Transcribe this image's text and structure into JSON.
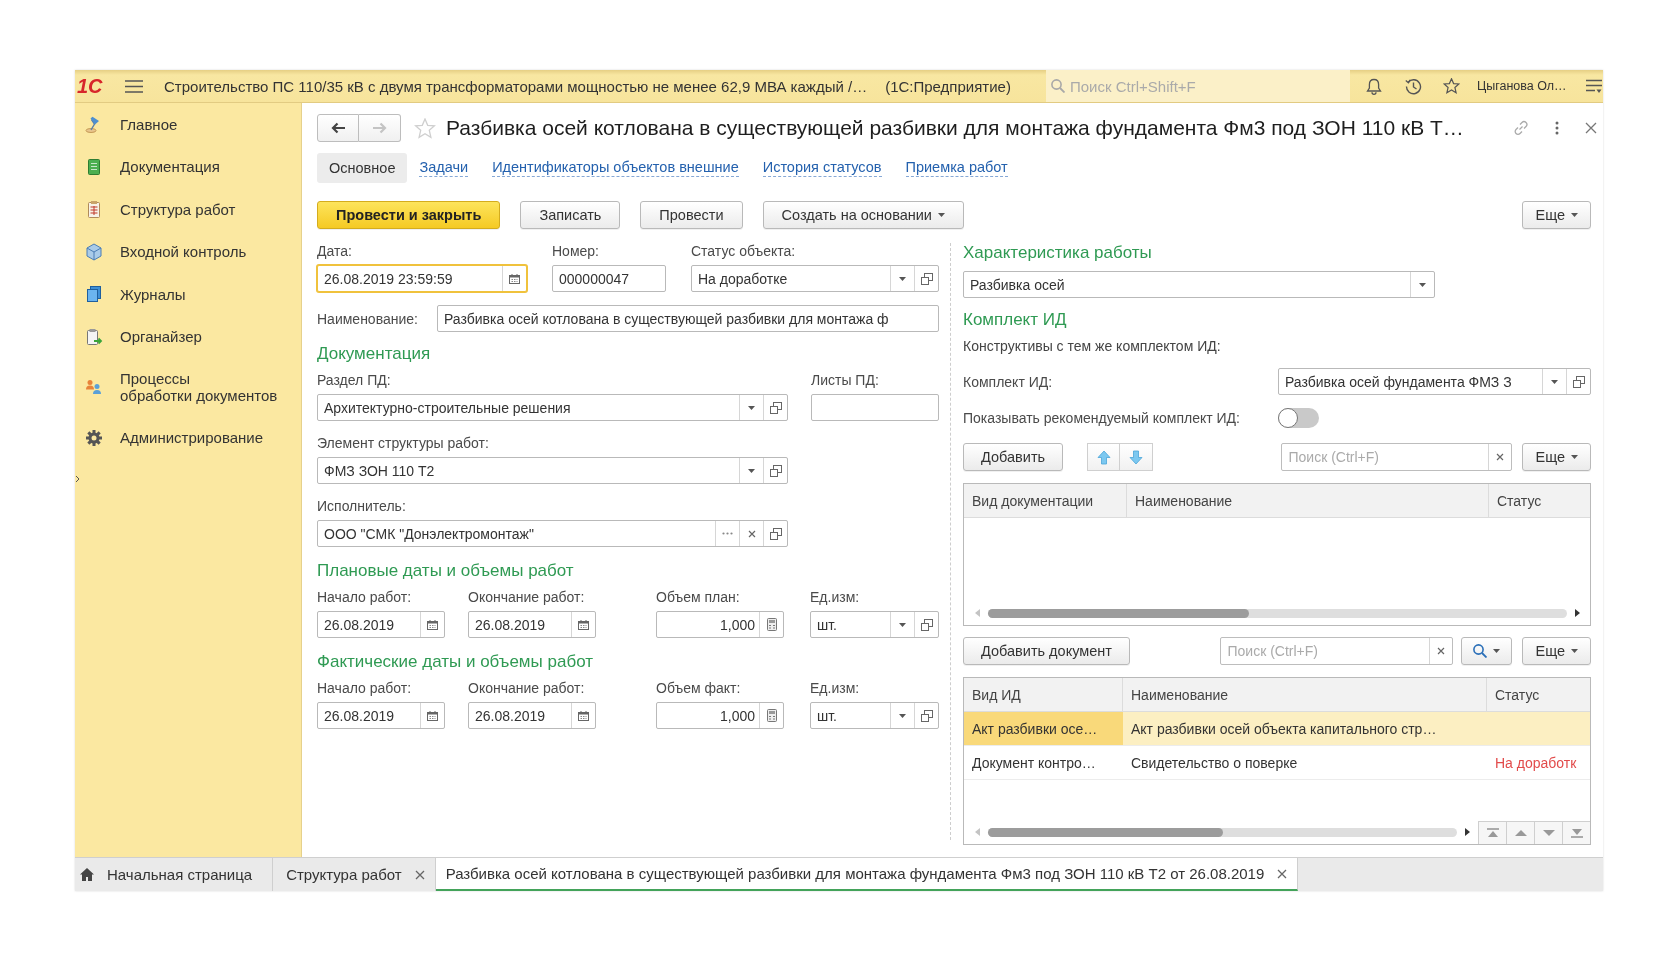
{
  "top_bar": {
    "logo": "1С",
    "title": "Строительство ПС 110/35 кВ с двумя трансформаторами мощностью не менее 62,9 МВА каждый /…",
    "app_name": "(1С:Предприятие)",
    "search": {
      "placeholder": "Поиск Ctrl+Shift+F"
    },
    "user": "Цыганова Ол…"
  },
  "sidebar": {
    "items": [
      {
        "label": "Главное"
      },
      {
        "label": "Документация"
      },
      {
        "label": "Структура работ"
      },
      {
        "label": "Входной контроль"
      },
      {
        "label": "Журналы"
      },
      {
        "label": "Органайзер"
      },
      {
        "label": "Процессы\nобработки документов"
      },
      {
        "label": "Администрирование"
      }
    ]
  },
  "form": {
    "nav_buttons": [
      {
        "kind": "back",
        "disabled": false
      },
      {
        "kind": "forward",
        "disabled": true
      }
    ],
    "favorite": false,
    "title": "Разбивка осей котлована в существующей разбивки для монтажа фундамента Фм3 под ЗОН 110 кВ Т…",
    "tabs": [
      {
        "label": "Основное",
        "selected": true
      },
      {
        "label": "Задачи",
        "selected": false
      },
      {
        "label": "Идентификаторы объектов внешние",
        "selected": false
      },
      {
        "label": "История статусов",
        "selected": false
      },
      {
        "label": "Приемка работ",
        "selected": false
      }
    ],
    "commands": [
      {
        "label": "Провести и закрыть",
        "kind": "primary"
      },
      {
        "label": "Записать",
        "kind": "plain"
      },
      {
        "label": "Провести",
        "kind": "plain"
      },
      {
        "label": "Создать на основании",
        "kind": "menu"
      }
    ],
    "more": "Еще",
    "header_fields": [
      {
        "label": "Дата:",
        "value": "26.08.2019 23:59:59",
        "kind": "date",
        "focused": true
      },
      {
        "label": "Номер:",
        "value": "000000047",
        "kind": "text",
        "focused": false
      },
      {
        "label": "Статус объекта:",
        "value": "На доработке",
        "kind": "select",
        "focused": false
      }
    ],
    "name_field": {
      "label": "Наименование:",
      "value": "Разбивка осей котлована в существующей разбивки для монтажа ф"
    },
    "documentation": {
      "heading": "Документация",
      "rows": [
        [
          {
            "label": "Раздел ПД:",
            "value": "Архитектурно-строительные решения",
            "kind": "select"
          },
          {
            "label": "Листы ПД:",
            "kind": "text"
          }
        ],
        [
          {
            "label": "Элемент структуры работ:",
            "value": "ФМЗ ЗОН 110 Т2",
            "kind": "select"
          }
        ],
        [
          {
            "label": "Исполнитель:",
            "value": "ООО \"СМК \"Донэлектромонтаж\"",
            "kind": "reference"
          }
        ]
      ]
    },
    "planned": {
      "heading": "Плановые даты и объемы работ",
      "fields": [
        {
          "label": "Начало работ:",
          "value": "26.08.2019",
          "kind": "date"
        },
        {
          "label": "Окончание работ:",
          "value": "26.08.2019",
          "kind": "date"
        },
        {
          "label": "Объем план:",
          "value": "1,000",
          "kind": "number"
        },
        {
          "label": "Ед.изм:",
          "value": "шт.",
          "kind": "select"
        }
      ]
    },
    "actual": {
      "heading": "Фактические даты и объемы работ",
      "fields": [
        {
          "label": "Начало работ:",
          "value": "26.08.2019",
          "kind": "date"
        },
        {
          "label": "Окончание работ:",
          "value": "26.08.2019",
          "kind": "date"
        },
        {
          "label": "Объем факт:",
          "value": "1,000",
          "kind": "number"
        },
        {
          "label": "Ед.изм:",
          "value": "шт.",
          "kind": "select"
        }
      ]
    }
  },
  "work_characteristic": {
    "heading": "Характеристика работы",
    "field": {
      "value": "Разбивка осей",
      "kind": "list"
    }
  },
  "id_set": {
    "heading": "Комплект ИД",
    "note": "Конструктивы с тем же комплектом ИД:",
    "field": {
      "label": "Комплект ИД:",
      "value": "Разбивка осей фундамента ФМЗ З",
      "kind": "select"
    },
    "toggle": {
      "label": "Показывать рекомендуемый комплект ИД:",
      "on": false
    },
    "toolbar": {
      "add": "Добавить",
      "search": {
        "placeholder": "Поиск (Ctrl+F)"
      },
      "more": "Еще"
    },
    "table": {
      "columns": [
        "Вид документации",
        "Наименование",
        "Статус"
      ]
    }
  },
  "documents": {
    "toolbar": {
      "add": "Добавить документ",
      "search": {
        "placeholder": "Поиск (Ctrl+F)"
      },
      "more": "Еще"
    },
    "table": {
      "columns": [
        "Вид ИД",
        "Наименование",
        "Статус"
      ],
      "rows": [
        {
          "type": "Акт разбивки осе…",
          "name": "Акт разбивки осей объекта капитального стр…",
          "selected": true
        },
        {
          "type": "Документ контро…",
          "name": "Свидетельство о поверке",
          "status": "На доработк",
          "selected": false
        }
      ]
    }
  },
  "open_windows": {
    "tabs": [
      {
        "label": "Начальная страница",
        "kind": "home",
        "selected": false
      },
      {
        "label": "Структура работ",
        "kind": "closable",
        "selected": false
      },
      {
        "label": "Разбивка осей котлована в существующей разбивки для монтажа фундамента Фм3 под ЗОН 110 кВ Т2 от 26.08.2019",
        "kind": "closable",
        "selected": true
      }
    ]
  }
}
